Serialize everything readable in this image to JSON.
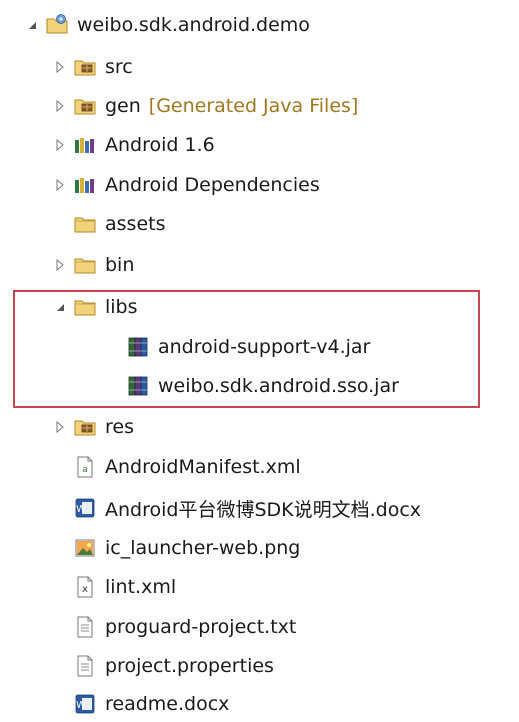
{
  "tree": {
    "project": {
      "label": "weibo.sdk.android.demo"
    },
    "src": {
      "label": "src"
    },
    "gen": {
      "label": "gen",
      "suffix": "[Generated Java Files]"
    },
    "android_lib": {
      "label": "Android 1.6"
    },
    "android_deps": {
      "label": "Android Dependencies"
    },
    "assets": {
      "label": "assets"
    },
    "bin": {
      "label": "bin"
    },
    "libs": {
      "label": "libs",
      "children": [
        {
          "label": "android-support-v4.jar"
        },
        {
          "label": "weibo.sdk.android.sso.jar"
        }
      ]
    },
    "res": {
      "label": "res"
    },
    "files": [
      {
        "label": "AndroidManifest.xml",
        "icon": "xml-manifest-icon"
      },
      {
        "label": "Android平台微博SDK说明文档.docx",
        "icon": "word-doc-icon"
      },
      {
        "label": "ic_launcher-web.png",
        "icon": "image-file-icon"
      },
      {
        "label": "lint.xml",
        "icon": "xml-file-icon"
      },
      {
        "label": "proguard-project.txt",
        "icon": "text-file-icon"
      },
      {
        "label": "project.properties",
        "icon": "text-file-icon"
      },
      {
        "label": "readme.docx",
        "icon": "word-doc-icon"
      }
    ]
  },
  "colors": {
    "highlight_border": "#c8464f",
    "folder": "#e9c46a",
    "generated_suffix": "#a07820",
    "jar_green": "#2f6b3a",
    "jar_purple": "#5b3a7a"
  }
}
